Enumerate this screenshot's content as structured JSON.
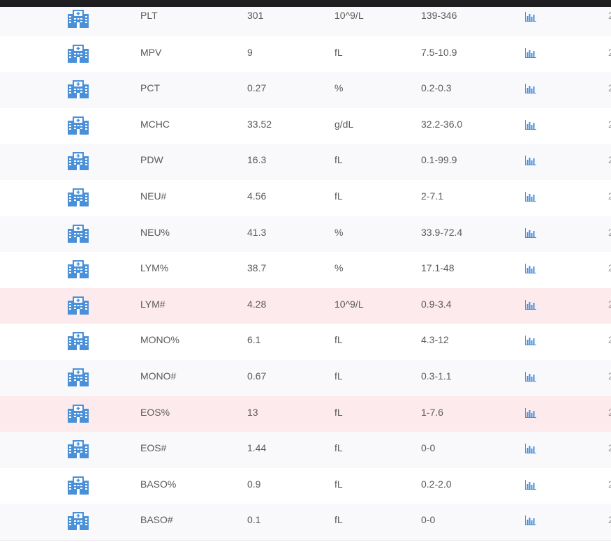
{
  "colors": {
    "accent": "#4a90d9",
    "abnormal_row": "#fdeaec",
    "stripe_row": "#f9f9fc"
  },
  "icons": {
    "row_icon": "hospital-building-icon",
    "trend_icon": "bar-chart-icon"
  },
  "rows": [
    {
      "name": "PLT",
      "value": "301",
      "unit": "10^9/L",
      "range": "139-346",
      "abnormal": false,
      "edge": "2"
    },
    {
      "name": "MPV",
      "value": "9",
      "unit": "fL",
      "range": "7.5-10.9",
      "abnormal": false,
      "edge": "2"
    },
    {
      "name": "PCT",
      "value": "0.27",
      "unit": "%",
      "range": "0.2-0.3",
      "abnormal": false,
      "edge": "2"
    },
    {
      "name": "MCHC",
      "value": "33.52",
      "unit": "g/dL",
      "range": "32.2-36.0",
      "abnormal": false,
      "edge": "2"
    },
    {
      "name": "PDW",
      "value": "16.3",
      "unit": "fL",
      "range": "0.1-99.9",
      "abnormal": false,
      "edge": "2"
    },
    {
      "name": "NEU#",
      "value": "4.56",
      "unit": "fL",
      "range": "2-7.1",
      "abnormal": false,
      "edge": "2"
    },
    {
      "name": "NEU%",
      "value": "41.3",
      "unit": "%",
      "range": "33.9-72.4",
      "abnormal": false,
      "edge": "2"
    },
    {
      "name": "LYM%",
      "value": "38.7",
      "unit": "%",
      "range": "17.1-48",
      "abnormal": false,
      "edge": "2"
    },
    {
      "name": "LYM#",
      "value": "4.28",
      "unit": "10^9/L",
      "range": "0.9-3.4",
      "abnormal": true,
      "edge": "2"
    },
    {
      "name": "MONO%",
      "value": "6.1",
      "unit": "fL",
      "range": "4.3-12",
      "abnormal": false,
      "edge": "2"
    },
    {
      "name": "MONO#",
      "value": "0.67",
      "unit": "fL",
      "range": "0.3-1.1",
      "abnormal": false,
      "edge": "2"
    },
    {
      "name": "EOS%",
      "value": "13",
      "unit": "fL",
      "range": "1-7.6",
      "abnormal": true,
      "edge": "2"
    },
    {
      "name": "EOS#",
      "value": "1.44",
      "unit": "fL",
      "range": "0-0",
      "abnormal": false,
      "edge": "2"
    },
    {
      "name": "BASO%",
      "value": "0.9",
      "unit": "fL",
      "range": "0.2-2.0",
      "abnormal": false,
      "edge": "2"
    },
    {
      "name": "BASO#",
      "value": "0.1",
      "unit": "fL",
      "range": "0-0",
      "abnormal": false,
      "edge": "2"
    }
  ]
}
